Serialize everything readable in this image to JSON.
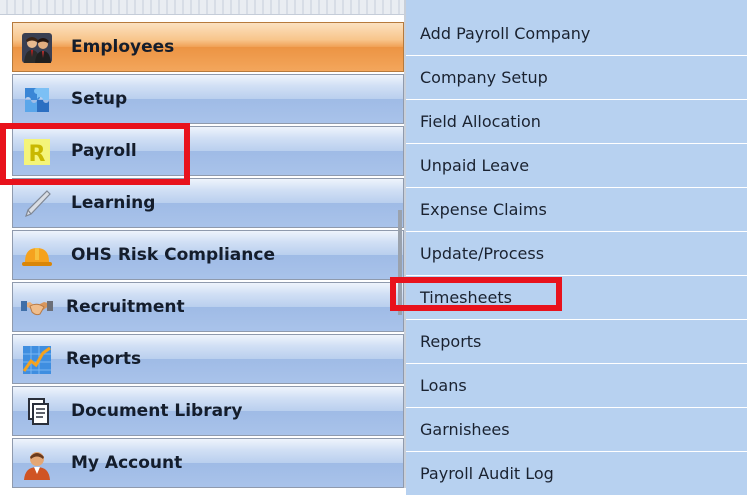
{
  "nav": {
    "items": [
      {
        "label": "Employees",
        "icon": "employees-icon",
        "active": true
      },
      {
        "label": "Setup",
        "icon": "setup-icon",
        "active": false
      },
      {
        "label": "Payroll",
        "icon": "payroll-icon",
        "active": false
      },
      {
        "label": "Learning",
        "icon": "learning-icon",
        "active": false
      },
      {
        "label": "OHS Risk Compliance",
        "icon": "hard-hat-icon",
        "active": false
      },
      {
        "label": "Recruitment",
        "icon": "handshake-icon",
        "active": false
      },
      {
        "label": "Reports",
        "icon": "reports-chart-icon",
        "active": false
      },
      {
        "label": "Document Library",
        "icon": "document-icon",
        "active": false
      },
      {
        "label": "My Account",
        "icon": "user-icon",
        "active": false
      }
    ]
  },
  "submenu": {
    "items": [
      {
        "label": "Add Payroll Company"
      },
      {
        "label": "Company Setup"
      },
      {
        "label": "Field Allocation"
      },
      {
        "label": "Unpaid Leave"
      },
      {
        "label": "Expense Claims"
      },
      {
        "label": "Update/Process"
      },
      {
        "label": "Timesheets"
      },
      {
        "label": "Reports"
      },
      {
        "label": "Loans"
      },
      {
        "label": "Garnishees"
      },
      {
        "label": "Payroll Audit Log"
      }
    ]
  },
  "colors": {
    "highlight": "#e8121c",
    "active_item": "#f0a155",
    "nav_item": "#b9cfee",
    "submenu_bg": "#b7d1f0"
  }
}
